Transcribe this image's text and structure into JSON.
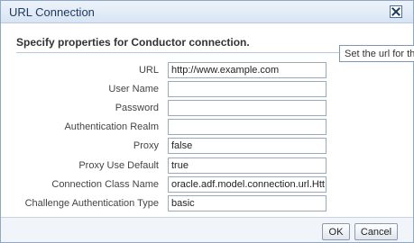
{
  "dialog": {
    "title": "URL Connection",
    "heading": "Specify properties for Conductor connection."
  },
  "tooltip": {
    "text": "Set the url for th"
  },
  "fields": [
    {
      "label": "URL",
      "value": "http://www.example.com"
    },
    {
      "label": "User Name",
      "value": ""
    },
    {
      "label": "Password",
      "value": ""
    },
    {
      "label": "Authentication Realm",
      "value": ""
    },
    {
      "label": "Proxy",
      "value": "false"
    },
    {
      "label": "Proxy Use Default",
      "value": "true"
    },
    {
      "label": "Connection Class Name",
      "value": "oracle.adf.model.connection.url.Htt"
    },
    {
      "label": "Challenge Authentication Type",
      "value": "basic"
    }
  ],
  "buttons": {
    "ok": "OK",
    "cancel": "Cancel"
  },
  "icons": {
    "close": "close-icon"
  },
  "colors": {
    "title_text": "#1d3a63",
    "title_bar": "#d8e4f3",
    "border": "#8fa8c8"
  }
}
